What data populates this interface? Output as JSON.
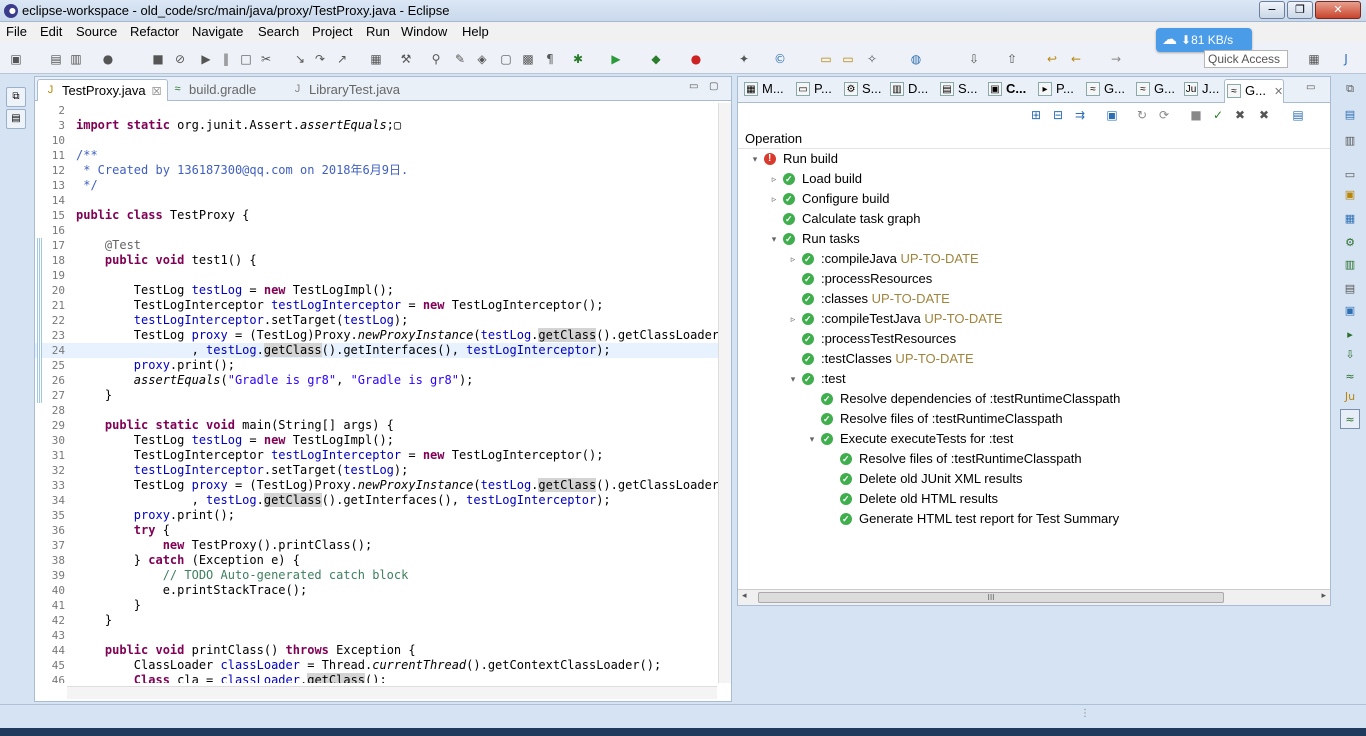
{
  "window": {
    "title": "eclipse-workspace - old_code/src/main/java/proxy/TestProxy.java - Eclipse",
    "minimize": "−",
    "maximize": "❐",
    "close": "✕"
  },
  "menu": [
    "File",
    "Edit",
    "Source",
    "Refactor",
    "Navigate",
    "Search",
    "Project",
    "Run",
    "Window",
    "Help"
  ],
  "network_badge": {
    "speed": "81 KB/s",
    "arrow": "⬇"
  },
  "quick_access": {
    "label": "Quick Access"
  },
  "editor": {
    "tabs": [
      {
        "label": "TestProxy.java",
        "active": true,
        "close": "☒"
      },
      {
        "label": "build.gradle",
        "active": false
      },
      {
        "label": "LibraryTest.java",
        "active": false
      }
    ],
    "lines": [
      {
        "n": "2",
        "t": ""
      },
      {
        "n": "3",
        "t": "import static org.junit.Assert.assertEquals;"
      },
      {
        "n": "10",
        "t": ""
      },
      {
        "n": "11",
        "t": "/**"
      },
      {
        "n": "12",
        "t": " * Created by 136187300@qq.com on 2018年6月9日."
      },
      {
        "n": "13",
        "t": " */"
      },
      {
        "n": "14",
        "t": ""
      },
      {
        "n": "15",
        "t": "public class TestProxy {"
      },
      {
        "n": "16",
        "t": ""
      },
      {
        "n": "17",
        "t": "    @Test"
      },
      {
        "n": "18",
        "t": "    public void test1() {"
      },
      {
        "n": "19",
        "t": ""
      },
      {
        "n": "20",
        "t": "        TestLog testLog = new TestLogImpl();"
      },
      {
        "n": "21",
        "t": "        TestLogInterceptor testLogInterceptor = new TestLogInterceptor();"
      },
      {
        "n": "22",
        "t": "        testLogInterceptor.setTarget(testLog);"
      },
      {
        "n": "23",
        "t": "        TestLog proxy = (TestLog)Proxy.newProxyInstance(testLog.getClass().getClassLoader()"
      },
      {
        "n": "24",
        "t": "                , testLog.getClass().getInterfaces(), testLogInterceptor);"
      },
      {
        "n": "25",
        "t": "        proxy.print();"
      },
      {
        "n": "26",
        "t": "        assertEquals(\"Gradle is gr8\", \"Gradle is gr8\");"
      },
      {
        "n": "27",
        "t": "    }"
      },
      {
        "n": "28",
        "t": ""
      },
      {
        "n": "29",
        "t": "    public static void main(String[] args) {"
      },
      {
        "n": "30",
        "t": "        TestLog testLog = new TestLogImpl();"
      },
      {
        "n": "31",
        "t": "        TestLogInterceptor testLogInterceptor = new TestLogInterceptor();"
      },
      {
        "n": "32",
        "t": "        testLogInterceptor.setTarget(testLog);"
      },
      {
        "n": "33",
        "t": "        TestLog proxy = (TestLog)Proxy.newProxyInstance(testLog.getClass().getClassLoader()"
      },
      {
        "n": "34",
        "t": "                , testLog.getClass().getInterfaces(), testLogInterceptor);"
      },
      {
        "n": "35",
        "t": "        proxy.print();"
      },
      {
        "n": "36",
        "t": "        try {"
      },
      {
        "n": "37",
        "t": "            new TestProxy().printClass();"
      },
      {
        "n": "38",
        "t": "        } catch (Exception e) {"
      },
      {
        "n": "39",
        "t": "            // TODO Auto-generated catch block"
      },
      {
        "n": "40",
        "t": "            e.printStackTrace();"
      },
      {
        "n": "41",
        "t": "        }"
      },
      {
        "n": "42",
        "t": "    }"
      },
      {
        "n": "43",
        "t": ""
      },
      {
        "n": "44",
        "t": "    public void printClass() throws Exception {"
      },
      {
        "n": "45",
        "t": "        ClassLoader classLoader = Thread.currentThread().getContextClassLoader();"
      },
      {
        "n": "46",
        "t": "        Class cla = classLoader.getClass();"
      }
    ]
  },
  "views": {
    "tabs": [
      "M...",
      "P...",
      "S...",
      "D...",
      "S...",
      "C...",
      "P...",
      "G...",
      "G...",
      "J...",
      "G..."
    ],
    "column_header": "Operation",
    "tree": [
      {
        "label": "Run build",
        "status": "err",
        "expand": "▾",
        "tag": ""
      },
      {
        "label": "Load build",
        "status": "ok",
        "expand": "▹",
        "tag": ""
      },
      {
        "label": "Configure build",
        "status": "ok",
        "expand": "▹",
        "tag": ""
      },
      {
        "label": "Calculate task graph",
        "status": "ok",
        "expand": "",
        "tag": ""
      },
      {
        "label": "Run tasks",
        "status": "ok",
        "expand": "▾",
        "tag": ""
      },
      {
        "label": ":compileJava",
        "status": "ok",
        "expand": "▹",
        "tag": "UP-TO-DATE"
      },
      {
        "label": ":processResources",
        "status": "ok",
        "expand": "",
        "tag": ""
      },
      {
        "label": ":classes",
        "status": "ok",
        "expand": "",
        "tag": "UP-TO-DATE"
      },
      {
        "label": ":compileTestJava",
        "status": "ok",
        "expand": "▹",
        "tag": "UP-TO-DATE"
      },
      {
        "label": ":processTestResources",
        "status": "ok",
        "expand": "",
        "tag": ""
      },
      {
        "label": ":testClasses",
        "status": "ok",
        "expand": "",
        "tag": "UP-TO-DATE"
      },
      {
        "label": ":test",
        "status": "ok",
        "expand": "▾",
        "tag": ""
      },
      {
        "label": "Resolve dependencies of :testRuntimeClasspath",
        "status": "ok",
        "expand": "",
        "tag": ""
      },
      {
        "label": "Resolve files of :testRuntimeClasspath",
        "status": "ok",
        "expand": "",
        "tag": ""
      },
      {
        "label": "Execute executeTests for :test",
        "status": "ok",
        "expand": "▾",
        "tag": ""
      },
      {
        "label": "Resolve files of :testRuntimeClasspath",
        "status": "ok",
        "expand": "",
        "tag": ""
      },
      {
        "label": "Delete old JUnit XML results",
        "status": "ok",
        "expand": "",
        "tag": ""
      },
      {
        "label": "Delete old HTML results",
        "status": "ok",
        "expand": "",
        "tag": ""
      },
      {
        "label": "Generate HTML test report for Test Summary",
        "status": "ok",
        "expand": "",
        "tag": ""
      }
    ],
    "scroll_grip": "III"
  },
  "colors": {
    "keyword": "#7f0055",
    "comment": "#3f5fbf",
    "string": "#2a00ff",
    "field": "#0000c0",
    "up_to_date": "#a0843e",
    "success": "#3fae4c",
    "failure": "#d83a2e"
  }
}
